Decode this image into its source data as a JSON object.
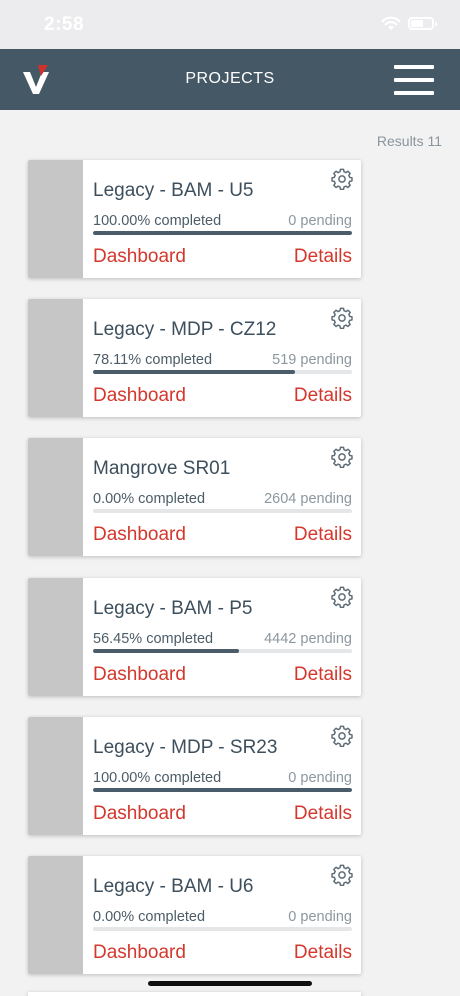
{
  "status_bar": {
    "time": "2:58"
  },
  "header": {
    "title": "PROJECTS"
  },
  "results_label": "Results 11",
  "projects": [
    {
      "name": "Legacy - BAM - U5",
      "completed": "100.00% completed",
      "pending": "0 pending",
      "progress": 100.0,
      "dashboard_label": "Dashboard",
      "details_label": "Details"
    },
    {
      "name": "Legacy - MDP - CZ12",
      "completed": "78.11% completed",
      "pending": "519 pending",
      "progress": 78.11,
      "dashboard_label": "Dashboard",
      "details_label": "Details"
    },
    {
      "name": "Mangrove SR01",
      "completed": "0.00% completed",
      "pending": "2604 pending",
      "progress": 0.0,
      "dashboard_label": "Dashboard",
      "details_label": "Details"
    },
    {
      "name": "Legacy - BAM - P5",
      "completed": "56.45% completed",
      "pending": "4442 pending",
      "progress": 56.45,
      "dashboard_label": "Dashboard",
      "details_label": "Details"
    },
    {
      "name": "Legacy - MDP - SR23",
      "completed": "100.00% completed",
      "pending": "0 pending",
      "progress": 100.0,
      "dashboard_label": "Dashboard",
      "details_label": "Details"
    },
    {
      "name": "Legacy - BAM - U6",
      "completed": "0.00% completed",
      "pending": "0 pending",
      "progress": 0.0,
      "dashboard_label": "Dashboard",
      "details_label": "Details"
    }
  ],
  "colors": {
    "header_bg": "#455866",
    "accent_link": "#d4372c",
    "progress_bar": "#4a5c6a",
    "logo_red": "#d0312d"
  },
  "icons": {
    "logo": "v-logo-icon",
    "menu": "hamburger-menu-icon",
    "settings": "gear-icon",
    "wifi": "wifi-icon",
    "battery": "battery-icon"
  }
}
